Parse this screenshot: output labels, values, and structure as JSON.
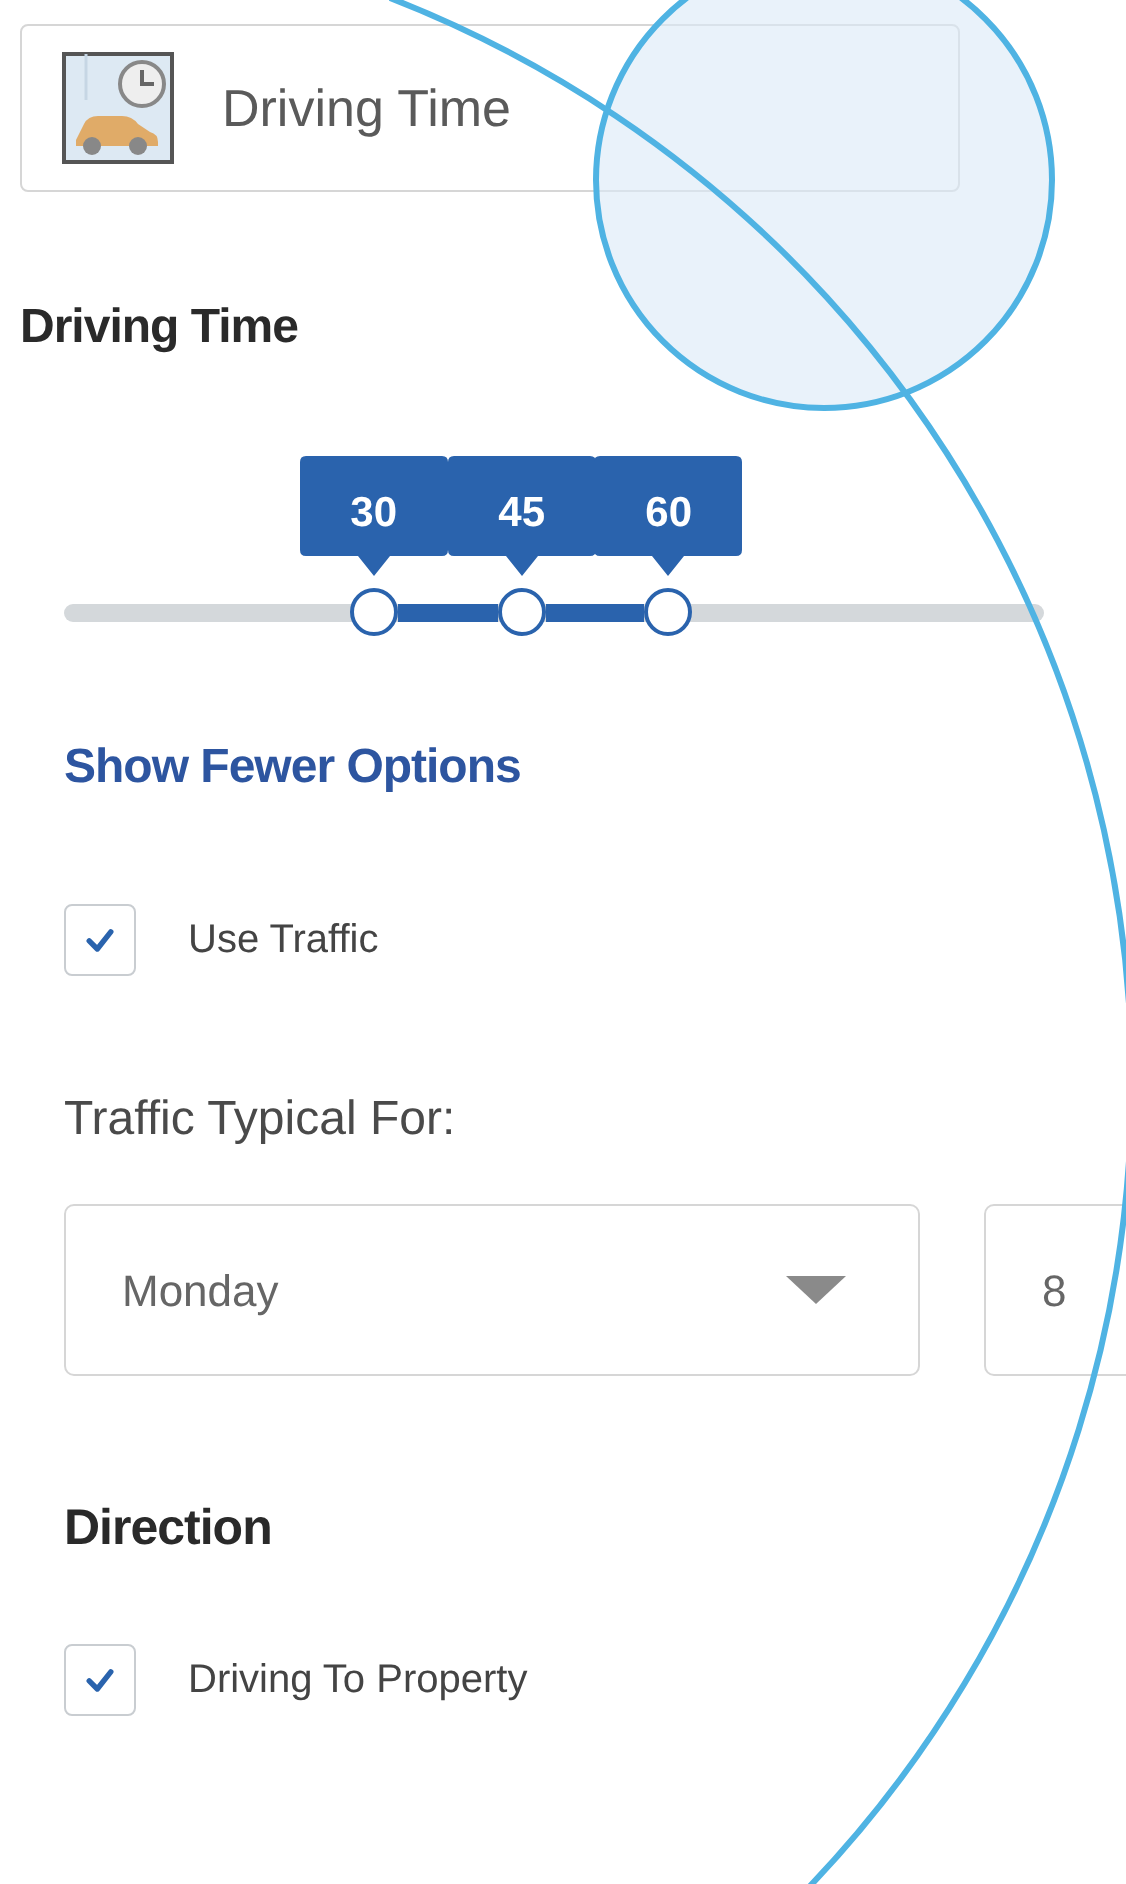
{
  "header": {
    "title": "Driving Time"
  },
  "section_title": "Driving Time",
  "slider": {
    "handles": [
      {
        "label": "30",
        "level": 0.316
      },
      {
        "label": "45",
        "level": 0.467
      },
      {
        "label": "60",
        "level": 0.617
      }
    ]
  },
  "toggle_link": "Show Fewer Options",
  "traffic_option": {
    "label": "Use Traffic",
    "checked": true
  },
  "traffic_label": "Traffic Typical For:",
  "selects": [
    {
      "value": "Monday",
      "kind": "dropdown"
    },
    {
      "value": "8",
      "kind": "field"
    }
  ],
  "direction": {
    "title": "Direction",
    "options": [
      {
        "label": "Driving To Property",
        "checked": true
      }
    ]
  }
}
